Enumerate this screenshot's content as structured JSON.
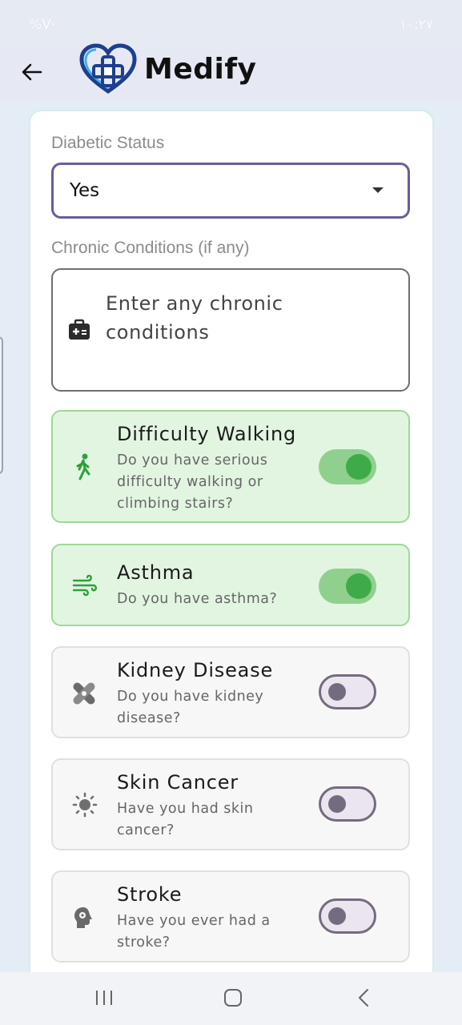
{
  "status_bar": {
    "left_text": "%V·",
    "right_text": "١٠:٢٧"
  },
  "header": {
    "title": "Medify",
    "back_icon": "arrow-left-icon",
    "logo_icon": "heart-cross-logo"
  },
  "form": {
    "diabetic_label": "Diabetic Status",
    "diabetic_value": "Yes",
    "chronic_label": "Chronic Conditions (if any)",
    "chronic_placeholder_line1": "Enter any chronic",
    "chronic_placeholder_line2": "conditions"
  },
  "conditions": [
    {
      "title": "Difficulty Walking",
      "desc1": "Do you have serious",
      "desc2": "difficulty walking or",
      "desc3": "climbing stairs?",
      "enabled": true,
      "icon": "walking-person-icon"
    },
    {
      "title": "Asthma",
      "desc1": "Do you have asthma?",
      "enabled": true,
      "icon": "wind-icon"
    },
    {
      "title": "Kidney Disease",
      "desc1": "Do you have kidney",
      "desc2": "disease?",
      "enabled": false,
      "icon": "bandage-icon"
    },
    {
      "title": "Skin Cancer",
      "desc1": "Have you had skin",
      "desc2": "cancer?",
      "enabled": false,
      "icon": "sun-icon"
    },
    {
      "title": "Stroke",
      "desc1": "Have you ever had a",
      "desc2": "stroke?",
      "enabled": false,
      "icon": "head-gear-icon"
    }
  ],
  "colors": {
    "on_bg": "#e2f5e1",
    "on_accent": "#3fab48",
    "select_border": "#6c5b9a",
    "logo_blue": "#2a6fd8"
  }
}
